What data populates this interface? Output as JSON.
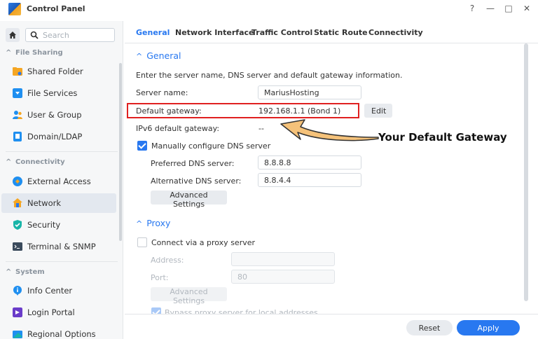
{
  "app": {
    "title": "Control Panel",
    "controls": [
      "?",
      "—",
      "□",
      "✕"
    ]
  },
  "sidebar": {
    "search_placeholder": "Search",
    "sections": [
      {
        "label": "File Sharing",
        "items": [
          {
            "label": "Shared Folder",
            "icon": "shared-folder-icon"
          },
          {
            "label": "File Services",
            "icon": "file-services-icon"
          },
          {
            "label": "User & Group",
            "icon": "user-group-icon"
          },
          {
            "label": "Domain/LDAP",
            "icon": "domain-ldap-icon"
          }
        ]
      },
      {
        "label": "Connectivity",
        "items": [
          {
            "label": "External Access",
            "icon": "external-access-icon"
          },
          {
            "label": "Network",
            "icon": "network-icon",
            "active": true
          },
          {
            "label": "Security",
            "icon": "security-icon"
          },
          {
            "label": "Terminal & SNMP",
            "icon": "terminal-icon"
          }
        ]
      },
      {
        "label": "System",
        "items": [
          {
            "label": "Info Center",
            "icon": "info-center-icon"
          },
          {
            "label": "Login Portal",
            "icon": "login-portal-icon"
          },
          {
            "label": "Regional Options",
            "icon": "regional-options-icon"
          }
        ]
      }
    ]
  },
  "tabs": [
    "General",
    "Network Interface",
    "Traffic Control",
    "Static Route",
    "Connectivity"
  ],
  "general": {
    "heading": "General",
    "description": "Enter the server name, DNS server and default gateway information.",
    "server_name_label": "Server name:",
    "server_name_value": "MariusHosting",
    "default_gateway_label": "Default gateway:",
    "default_gateway_value": "192.168.1.1 (Bond 1)",
    "edit_label": "Edit",
    "ipv6_label": "IPv6 default gateway:",
    "ipv6_value": "--",
    "manual_dns_label": "Manually configure DNS server",
    "manual_dns_checked": true,
    "preferred_dns_label": "Preferred DNS server:",
    "preferred_dns_value": "8.8.8.8",
    "alternative_dns_label": "Alternative DNS server:",
    "alternative_dns_value": "8.8.4.4",
    "advanced_settings_label": "Advanced Settings"
  },
  "proxy": {
    "heading": "Proxy",
    "connect_label": "Connect via a proxy server",
    "connect_checked": false,
    "address_label": "Address:",
    "address_value": "",
    "port_label": "Port:",
    "port_value": "80",
    "advanced_settings_label": "Advanced Settings",
    "bypass_label": "Bypass proxy server for local addresses",
    "bypass_checked": true
  },
  "annotation": {
    "callout": "Your Default Gateway",
    "highlight_color": "#e02020",
    "arrow_color": "#f5c27a"
  },
  "footer": {
    "reset_label": "Reset",
    "apply_label": "Apply"
  },
  "colors": {
    "accent": "#2878f0"
  }
}
